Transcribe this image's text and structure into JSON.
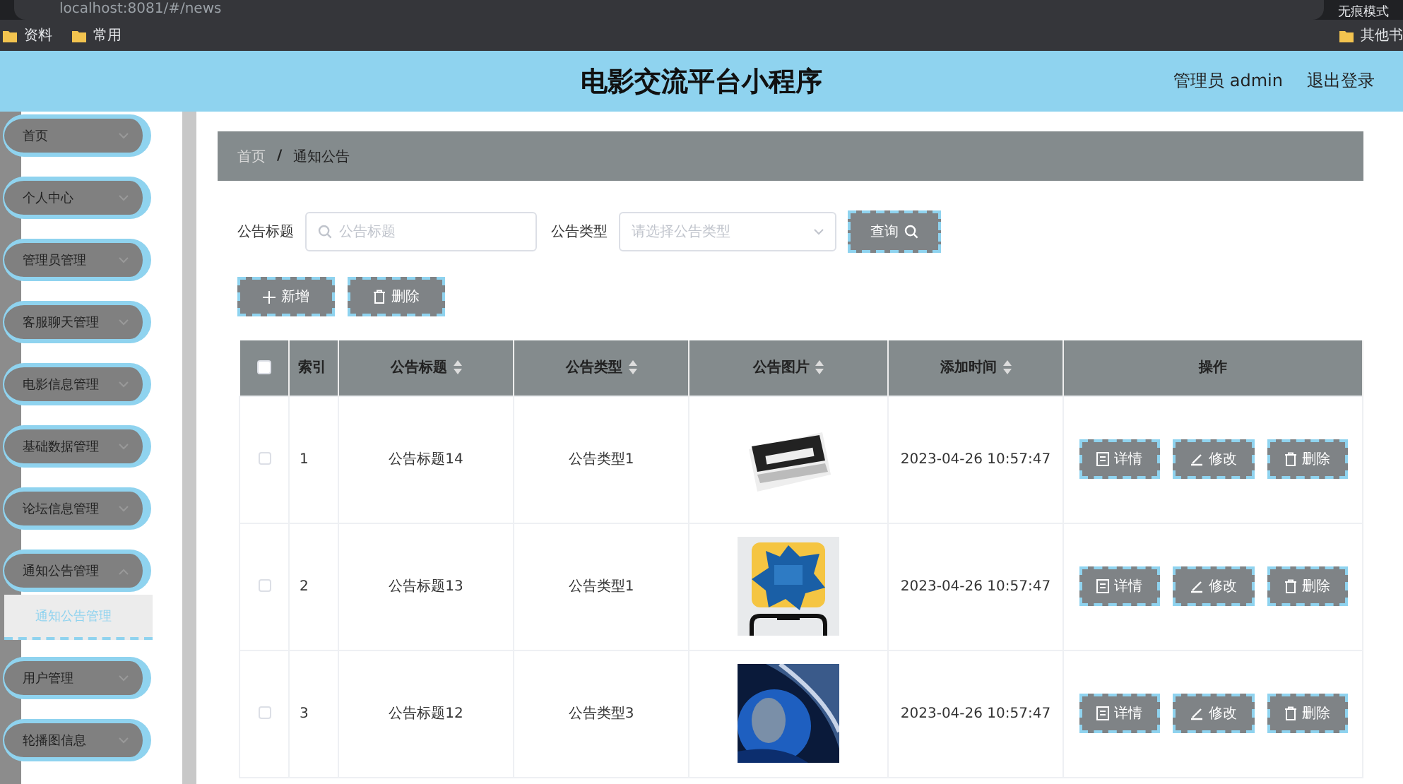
{
  "browser": {
    "url": "localhost:8081/#/news",
    "mode_badge": "无痕模式",
    "bookmarks": [
      "资料",
      "常用"
    ],
    "other_bookmarks": "其他书"
  },
  "header": {
    "title": "电影交流平台小程序",
    "user": "管理员 admin",
    "logout": "退出登录"
  },
  "sidebar": {
    "items": [
      {
        "label": "首页",
        "expanded": false
      },
      {
        "label": "个人中心",
        "expanded": false
      },
      {
        "label": "管理员管理",
        "expanded": false
      },
      {
        "label": "客服聊天管理",
        "expanded": false
      },
      {
        "label": "电影信息管理",
        "expanded": false
      },
      {
        "label": "基础数据管理",
        "expanded": false
      },
      {
        "label": "论坛信息管理",
        "expanded": false
      },
      {
        "label": "通知公告管理",
        "expanded": true,
        "children": [
          {
            "label": "通知公告管理",
            "selected": true
          }
        ]
      },
      {
        "label": "用户管理",
        "expanded": false
      },
      {
        "label": "轮播图信息",
        "expanded": false
      }
    ]
  },
  "breadcrumb": [
    "首页",
    "通知公告"
  ],
  "breadcrumb_separator": "/",
  "search": {
    "title_label": "公告标题",
    "title_placeholder": "公告标题",
    "type_label": "公告类型",
    "type_placeholder": "请选择公告类型",
    "query": "查询"
  },
  "actions": [
    "新增",
    "删除"
  ],
  "table": {
    "columns": [
      {
        "label": "索引",
        "sortable": false
      },
      {
        "label": "公告标题",
        "sortable": true
      },
      {
        "label": "公告类型",
        "sortable": true
      },
      {
        "label": "公告图片",
        "sortable": true
      },
      {
        "label": "添加时间",
        "sortable": true
      },
      {
        "label": "操作",
        "sortable": false
      }
    ],
    "header_checked": false,
    "rows": [
      {
        "checked": false,
        "index": "1",
        "title": "公告标题14",
        "type": "公告类型1",
        "time": "2023-04-26 10:57:47",
        "buttons": [
          "详情",
          "修改",
          "删除"
        ]
      },
      {
        "checked": false,
        "index": "2",
        "title": "公告标题13",
        "type": "公告类型1",
        "time": "2023-04-26 10:57:47",
        "buttons": [
          "详情",
          "修改",
          "删除"
        ]
      },
      {
        "checked": false,
        "index": "3",
        "title": "公告标题12",
        "type": "公告类型3",
        "time": "2023-04-26 10:57:47",
        "buttons": [
          "详情",
          "修改",
          "删除"
        ]
      }
    ]
  }
}
